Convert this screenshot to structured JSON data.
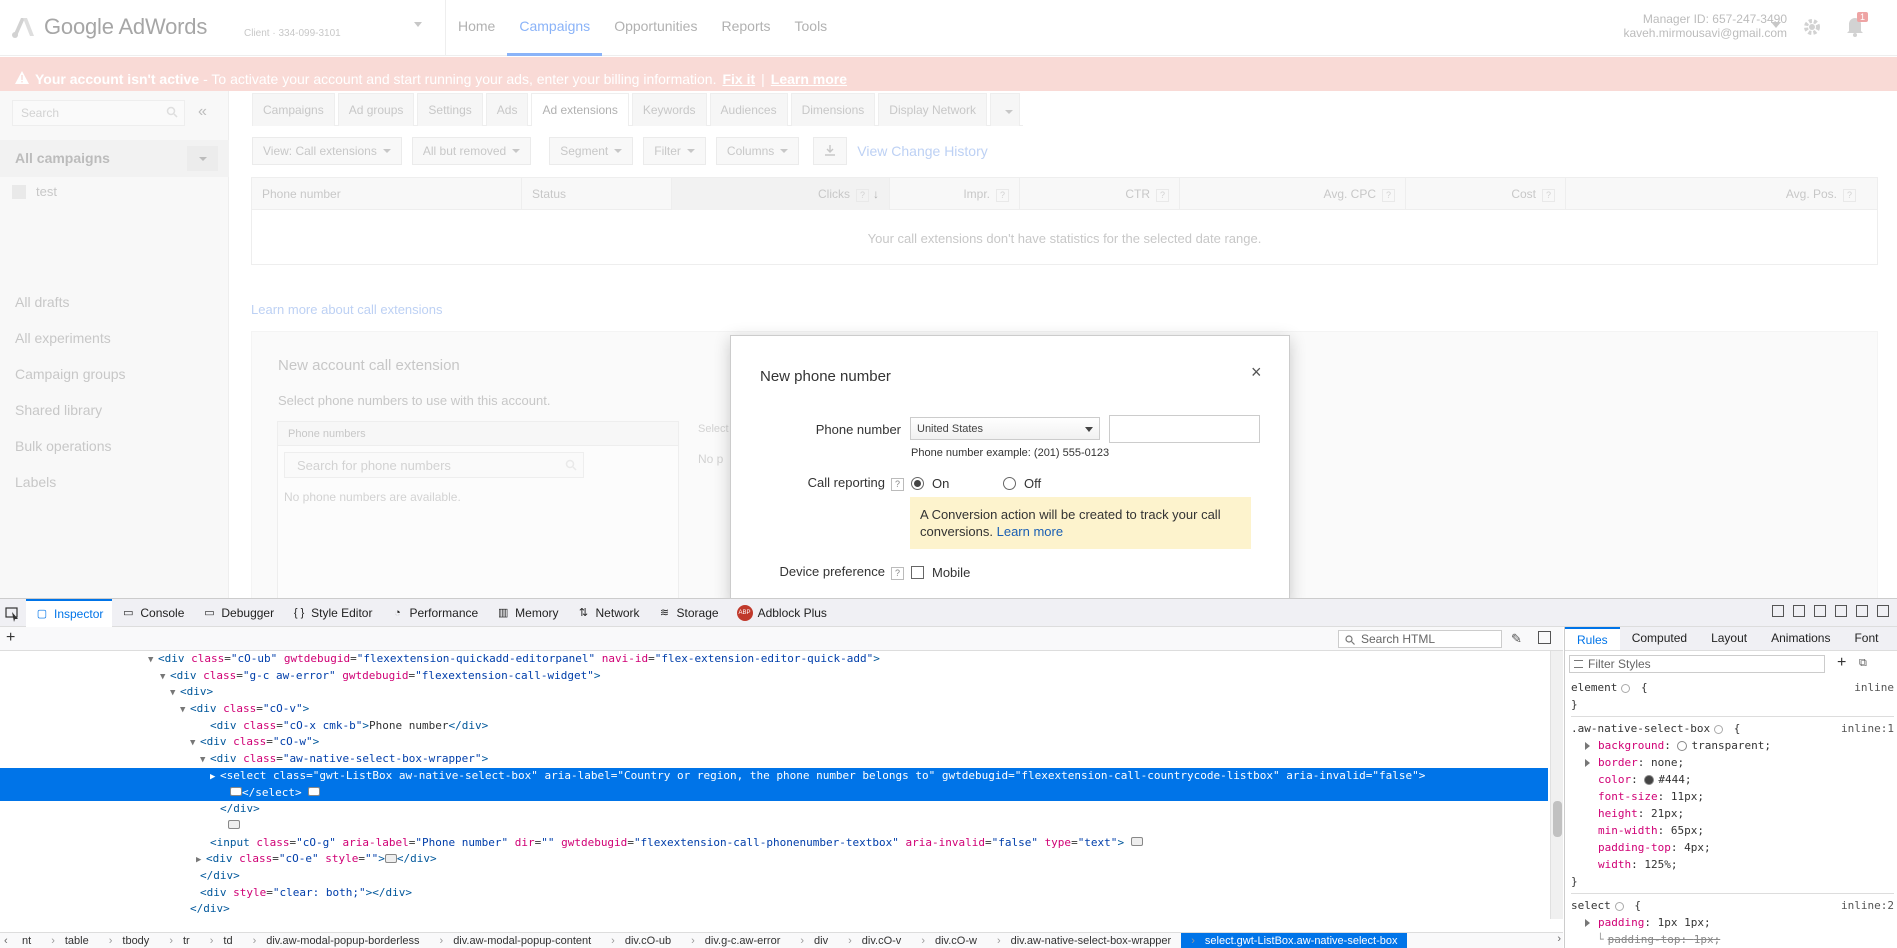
{
  "app": {
    "logo_text": "Google AdWords",
    "client_name": "Client",
    "client_id": "334-099-3101",
    "nav": [
      "Home",
      "Campaigns",
      "Opportunities",
      "Reports",
      "Tools"
    ],
    "nav_active": "Campaigns",
    "manager_id": "Manager ID: 657-247-3490",
    "email": "kaveh.mirmousavi@gmail.com",
    "notification_count": "1",
    "banner": {
      "title": "Your account isn't active",
      "message": " - To activate your account and start running your ads, enter your billing information.",
      "fix_it": "Fix it",
      "separator": "|",
      "learn_more": "Learn more"
    },
    "sidebar": {
      "search_placeholder": "Search",
      "collapse": "«",
      "all_campaigns": "All campaigns",
      "campaign": "test",
      "links": [
        "All drafts",
        "All experiments",
        "Campaign groups",
        "Shared library",
        "Bulk operations",
        "Labels"
      ]
    },
    "tabs": [
      "Campaigns",
      "Ad groups",
      "Settings",
      "Ads",
      "Ad extensions",
      "Keywords",
      "Audiences",
      "Dimensions",
      "Display Network"
    ],
    "tab_active": "Ad extensions",
    "toolbar": {
      "view": "View: Call extensions",
      "filter_removed": "All but removed",
      "segment": "Segment",
      "filter": "Filter",
      "columns": "Columns",
      "view_history": "View Change History"
    },
    "table": {
      "columns": [
        "Phone number",
        "Status",
        "Clicks",
        "Impr.",
        "CTR",
        "Avg. CPC",
        "Cost",
        "Avg. Pos."
      ],
      "help": "?",
      "sort": "↓",
      "empty": "Your call extensions don't have statistics for the selected date range."
    },
    "learn_call_ext": "Learn more about call extensions",
    "account_panel": {
      "title": "New account call extension",
      "subtitle": "Select phone numbers to use with this account.",
      "phones_header": "Phone numbers",
      "search_placeholder": "Search for phone numbers",
      "none": "No phone numbers are available.",
      "selected_label": "Select",
      "no_label": "No p"
    }
  },
  "modal": {
    "title": "New phone number",
    "close": "×",
    "phone_label": "Phone number",
    "country": "United States",
    "phone_value": "",
    "example": "Phone number example: (201) 555-0123",
    "call_reporting_label": "Call reporting",
    "help": "?",
    "on": "On",
    "off": "Off",
    "call_reporting": "On",
    "note": "A Conversion action will be created to track your call conversions.",
    "note_link": "Learn more",
    "device_label": "Device preference",
    "mobile": "Mobile",
    "mobile_checked": false
  },
  "devtools": {
    "tabs": [
      "Inspector",
      "Console",
      "Debugger",
      "Style Editor",
      "Performance",
      "Memory",
      "Network",
      "Storage",
      "Adblock Plus"
    ],
    "tab_icons": [
      "▢",
      "▭",
      "▭",
      "{ }",
      "◔",
      "▥",
      "⇅",
      "≋",
      "ABP"
    ],
    "active_tab": "Inspector",
    "search_placeholder": "Search HTML",
    "tree": [
      {
        "indent": 148,
        "tw": "▼",
        "html": "<span class=\"tag\">&lt;div</span> <span class=\"an\">class</span>=<span class=\"av\">\"cO-ub\"</span> <span class=\"an\">gwtdebugid</span>=<span class=\"av\">\"flexextension-quickadd-editorpanel\"</span> <span class=\"an\">navi-id</span>=<span class=\"av\">\"flex-extension-editor-quick-add\"</span><span class=\"tag\">&gt;</span>"
      },
      {
        "indent": 160,
        "tw": "▼",
        "html": "<span class=\"tag\">&lt;div</span> <span class=\"an\">class</span>=<span class=\"av\">\"g-c aw-error\"</span> <span class=\"an\">gwtdebugid</span>=<span class=\"av\">\"flexextension-call-widget\"</span><span class=\"tag\">&gt;</span>"
      },
      {
        "indent": 170,
        "tw": "▼",
        "html": "<span class=\"tag\">&lt;div&gt;</span>"
      },
      {
        "indent": 180,
        "tw": "▼",
        "html": "<span class=\"tag\">&lt;div</span> <span class=\"an\">class</span>=<span class=\"av\">\"cO-v\"</span><span class=\"tag\">&gt;</span>"
      },
      {
        "indent": 200,
        "tw": "",
        "html": "<span class=\"tag\">&lt;div</span> <span class=\"an\">class</span>=<span class=\"av\">\"cO-x cmk-b\"</span><span class=\"tag\">&gt;</span>Phone number<span class=\"tag\">&lt;/div&gt;</span>"
      },
      {
        "indent": 190,
        "tw": "▼",
        "html": "<span class=\"tag\">&lt;div</span> <span class=\"an\">class</span>=<span class=\"av\">\"cO-w\"</span><span class=\"tag\">&gt;</span>"
      },
      {
        "indent": 200,
        "tw": "▼",
        "html": "<span class=\"tag\">&lt;div</span> <span class=\"an\">class</span>=<span class=\"av\">\"aw-native-select-box-wrapper\"</span><span class=\"tag\">&gt;</span>"
      },
      {
        "indent": 210,
        "tw": "▶",
        "sel": true,
        "html": "<span class=\"tag\">&lt;select</span> <span class=\"an\">class</span>=<span class=\"av\">\"gwt-ListBox aw-native-select-box\"</span> <span class=\"an\">aria-label</span>=<span class=\"av\">\"Country or region, the phone number belongs to\"</span> <span class=\"an\">gwtdebugid</span>=<span class=\"av\">\"flexextension-call-countrycode-listbox\"</span> <span class=\"an\">aria-invalid</span>=<span class=\"av\">\"false\"</span><span class=\"tag\">&gt;</span>"
      },
      {
        "indent": 220,
        "tw": "",
        "sel": true,
        "html": "<span class=\"badge-ell\"></span><span class=\"tag\">&lt;/select&gt;</span> <span class=\"badge-ell\"></span>"
      },
      {
        "indent": 210,
        "tw": "",
        "html": "<span class=\"tag\">&lt;/div&gt;</span>"
      },
      {
        "indent": 218,
        "tw": "",
        "html": "<span class=\"badge-ell\"></span>"
      },
      {
        "indent": 200,
        "tw": "",
        "html": "<span class=\"tag\">&lt;input</span> <span class=\"an\">class</span>=<span class=\"av\">\"cO-g\"</span> <span class=\"an\">aria-label</span>=<span class=\"av\">\"Phone number\"</span> <span class=\"an\">dir</span>=<span class=\"av\">\"\"</span> <span class=\"an\">gwtdebugid</span>=<span class=\"av\">\"flexextension-call-phonenumber-textbox\"</span> <span class=\"an\">aria-invalid</span>=<span class=\"av\">\"false\"</span> <span class=\"an\">type</span>=<span class=\"av\">\"text\"</span><span class=\"tag\">&gt;</span> <span class=\"badge-ell\"></span>"
      },
      {
        "indent": 196,
        "tw": "▶",
        "html": "<span class=\"tag\">&lt;div</span> <span class=\"an\">class</span>=<span class=\"av\">\"cO-e\"</span> <span class=\"an\">style</span>=<span class=\"av\">\"\"</span><span class=\"tag\">&gt;</span><span class=\"badge-ell\"></span><span class=\"tag\">&lt;/div&gt;</span>"
      },
      {
        "indent": 190,
        "tw": "",
        "html": "<span class=\"tag\">&lt;/div&gt;</span>"
      },
      {
        "indent": 190,
        "tw": "",
        "html": "<span class=\"tag\">&lt;div</span> <span class=\"an\">style</span>=<span class=\"av\">\"clear: both;\"</span><span class=\"tag\">&gt;&lt;/div&gt;</span>"
      },
      {
        "indent": 180,
        "tw": "",
        "html": "<span class=\"tag\">&lt;/div&gt;</span>"
      }
    ],
    "breadcrumbs": [
      "nt",
      "table",
      "tbody",
      "tr",
      "td",
      "div.aw-modal-popup-borderless",
      "div.aw-modal-popup-content",
      "div.cO-ub",
      "div.g-c.aw-error",
      "div",
      "div.cO-v",
      "div.cO-w",
      "div.aw-native-select-box-wrapper",
      "select.gwt-ListBox.aw-native-select-box"
    ],
    "rules_tabs": [
      "Rules",
      "Computed",
      "Layout",
      "Animations",
      "Font"
    ],
    "rules_active": "Rules",
    "filter_placeholder": "Filter Styles",
    "rules": {
      "element_selector": "element",
      "element_source": "inline",
      "rule1_selector": ".aw-native-select-box",
      "rule1_source": "inline:1",
      "rule1_props": [
        {
          "name": "background",
          "value": "transparent",
          "expand": true,
          "swatch": "transparent"
        },
        {
          "name": "border",
          "value": "none",
          "expand": true
        },
        {
          "name": "color",
          "value": "#444",
          "swatch": "#444"
        },
        {
          "name": "font-size",
          "value": "11px"
        },
        {
          "name": "height",
          "value": "21px"
        },
        {
          "name": "min-width",
          "value": "65px"
        },
        {
          "name": "padding-top",
          "value": "4px"
        },
        {
          "name": "width",
          "value": "125%"
        }
      ],
      "rule2_selector": "select",
      "rule2_source": "inline:2",
      "rule2_props": [
        {
          "name": "padding",
          "value": "1px 1px",
          "expand": true
        },
        {
          "name": "padding-top",
          "value": "1px",
          "struck": true
        }
      ]
    }
  }
}
